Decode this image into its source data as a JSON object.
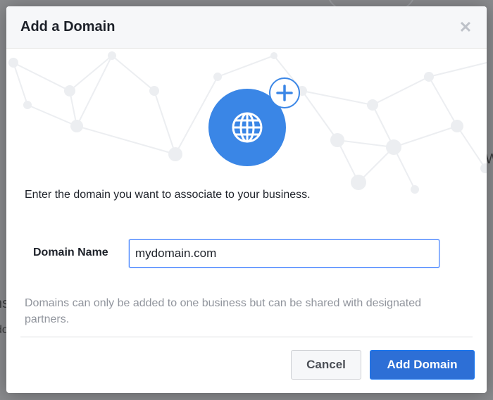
{
  "dialog": {
    "title": "Add a Domain",
    "close_icon": "close-icon",
    "hero_icons": [
      "globe-icon",
      "plus-icon"
    ],
    "intro_text": "Enter the domain you want to associate to your business.",
    "field_label": "Domain Name",
    "domain_value": "mydomain.com",
    "note_text": "Domains can only be added to one business but can be shared with designated partners.",
    "cancel_label": "Cancel",
    "add_label": "Add Domain"
  },
  "colors": {
    "accent": "#3a86e6",
    "primary_button": "#2d6fd6",
    "text": "#1d2129",
    "muted_text": "#90949c"
  }
}
